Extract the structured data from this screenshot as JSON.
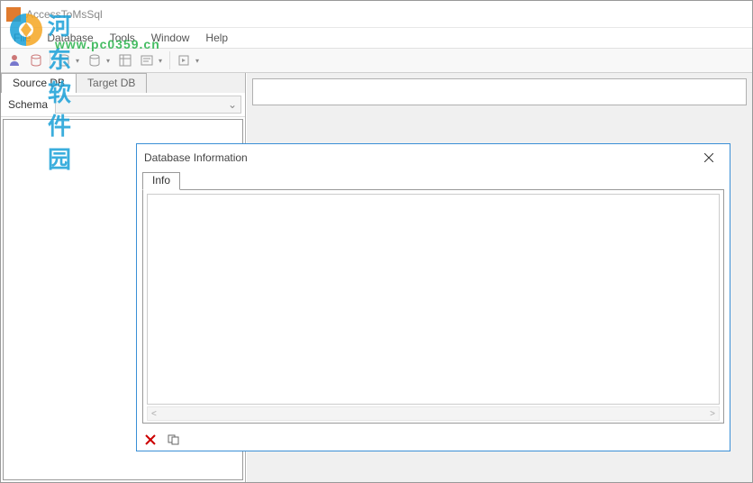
{
  "titlebar": {
    "title": "AccessToMsSql"
  },
  "menubar": {
    "items": [
      "File",
      "Database",
      "Tools",
      "Window",
      "Help"
    ]
  },
  "toolbar": {
    "icons": [
      "user-icon",
      "db-icon",
      "db-icon",
      "grid-icon",
      "grid-icon",
      "query-icon",
      "refresh-icon"
    ]
  },
  "left": {
    "tabs": {
      "source": "Source DB",
      "target": "Target DB"
    },
    "schema_label": "Schema",
    "schema_value": ""
  },
  "dialog": {
    "title": "Database Information",
    "tab": "Info",
    "content": "",
    "footer_icons": [
      "delete-icon",
      "copy-icon"
    ]
  },
  "watermark": {
    "line1": "河东软件园",
    "line2": "www.pc0359.cn"
  }
}
